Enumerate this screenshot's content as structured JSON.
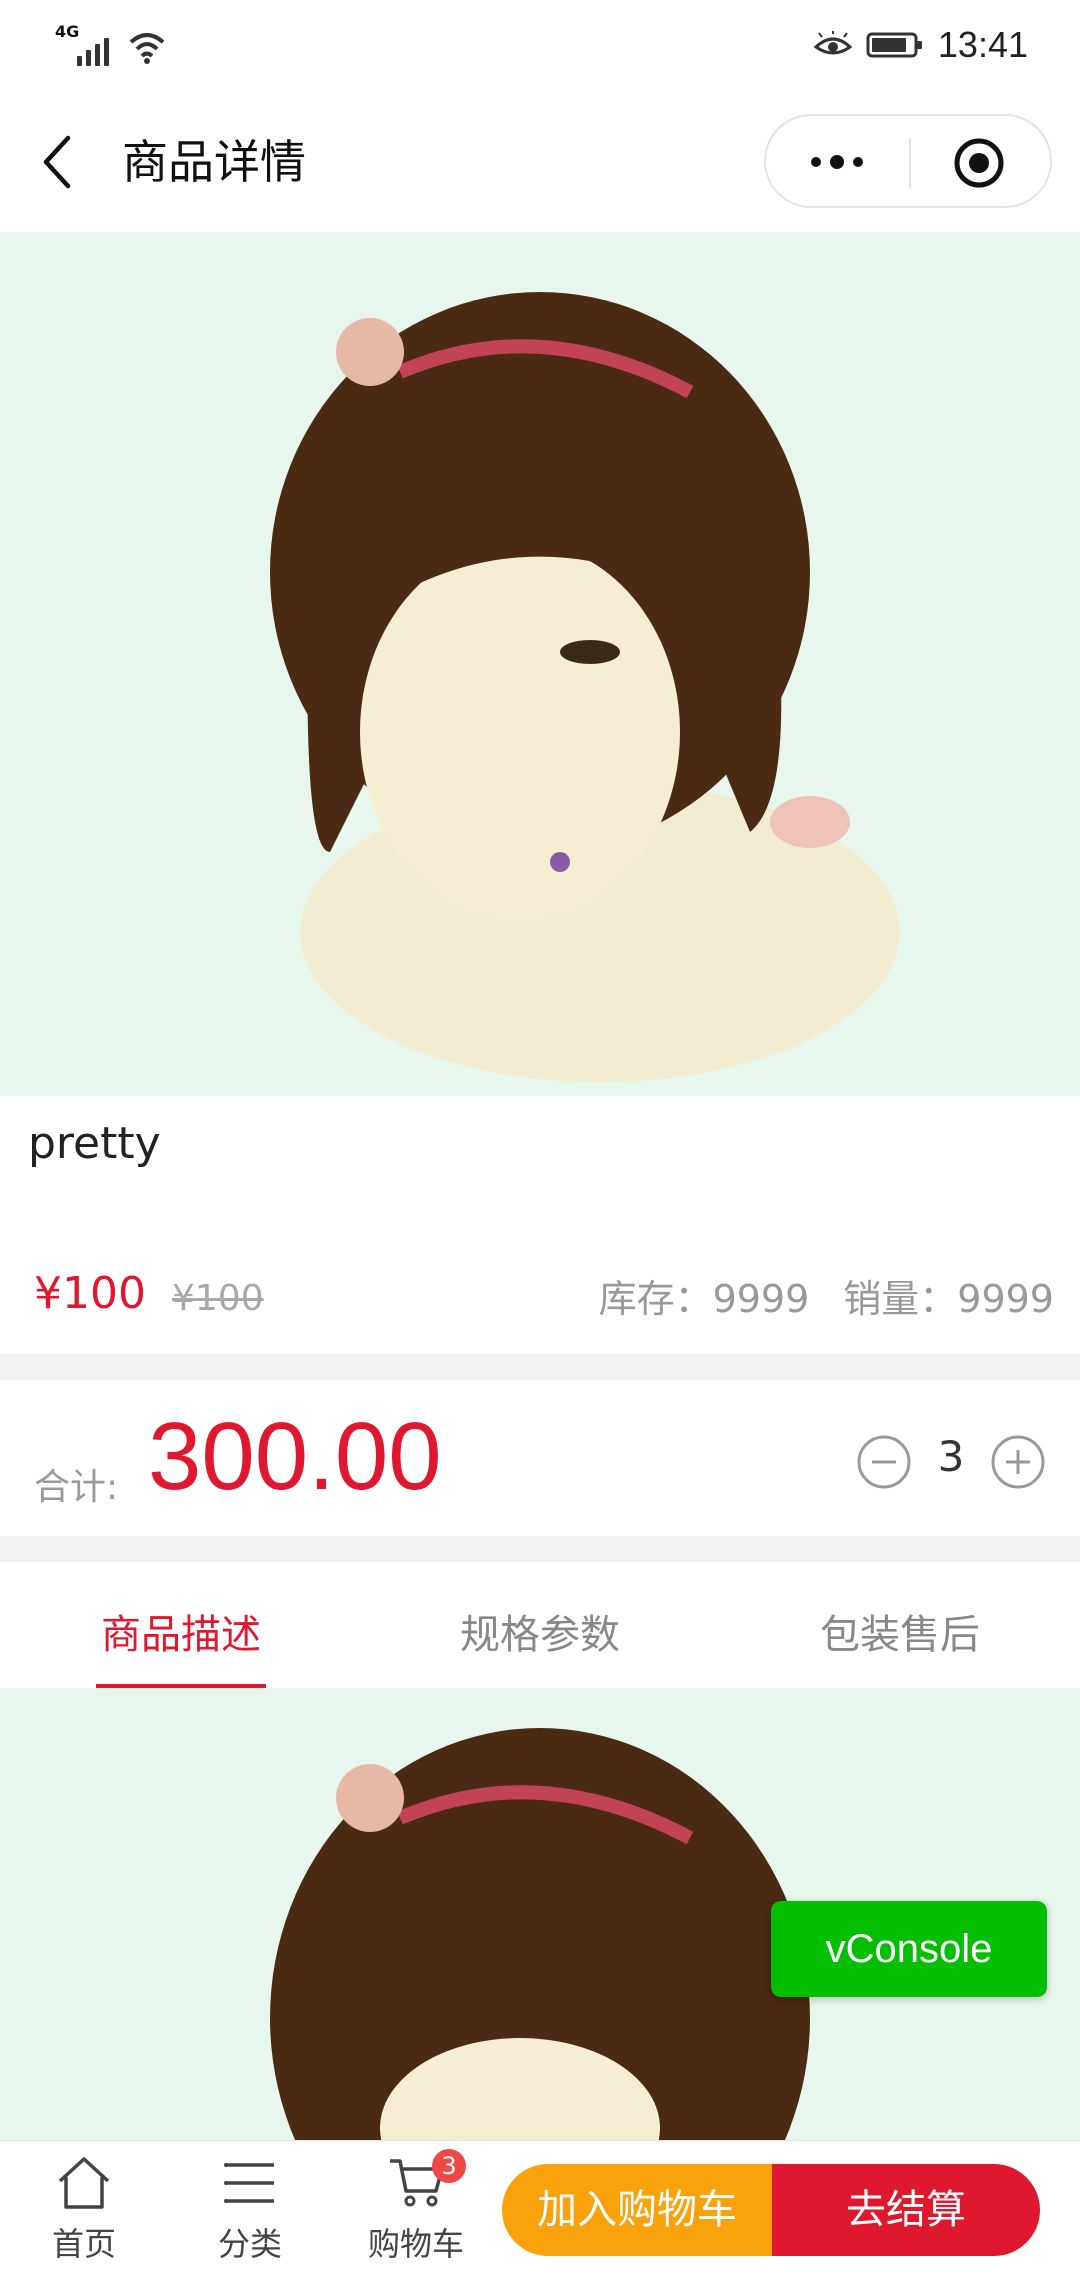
{
  "status_bar": {
    "network": "4G",
    "time": "13:41"
  },
  "nav": {
    "title": "商品详情"
  },
  "product": {
    "name": "pretty",
    "price": "¥100",
    "original_price": "¥100",
    "stock": "库存：9999",
    "sales": "销量：9999"
  },
  "total": {
    "label": "合计:",
    "value": "300.00",
    "quantity": "3"
  },
  "tabs": [
    {
      "label": "商品描述",
      "active": true
    },
    {
      "label": "规格参数",
      "active": false
    },
    {
      "label": "包装售后",
      "active": false
    }
  ],
  "vconsole": {
    "label": "vConsole"
  },
  "bottom_nav": {
    "home": "首页",
    "category": "分类",
    "cart": "购物车",
    "cart_badge": "3",
    "add_to_cart": "加入购物车",
    "checkout": "去结算"
  },
  "colors": {
    "accent": "#e0182f",
    "add_button": "#f9a20b",
    "vconsole": "#04be02",
    "image_bg": "#e8f7ed"
  }
}
